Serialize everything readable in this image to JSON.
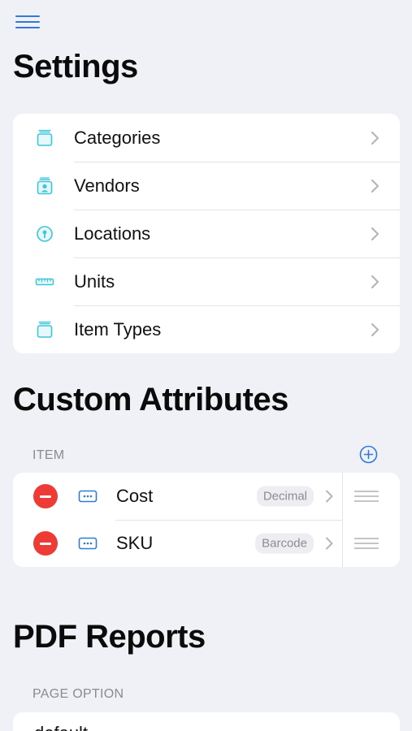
{
  "settings": {
    "title": "Settings",
    "items": [
      {
        "label": "Categories",
        "icon": "tray-icon"
      },
      {
        "label": "Vendors",
        "icon": "person-card-icon"
      },
      {
        "label": "Locations",
        "icon": "location-pin-icon"
      },
      {
        "label": "Units",
        "icon": "ruler-icon"
      },
      {
        "label": "Item Types",
        "icon": "tray-icon"
      }
    ]
  },
  "custom_attributes": {
    "title": "Custom Attributes",
    "group_label": "ITEM",
    "rows": [
      {
        "label": "Cost",
        "type": "Decimal"
      },
      {
        "label": "SKU",
        "type": "Barcode"
      }
    ]
  },
  "pdf_reports": {
    "title": "PDF Reports",
    "group_label": "PAGE OPTION",
    "first_value": "default"
  },
  "colors": {
    "accent": "#2f7ad6",
    "icon_teal": "#3cc6d8",
    "delete_red": "#ee3b35",
    "background": "#f0f1f7"
  }
}
